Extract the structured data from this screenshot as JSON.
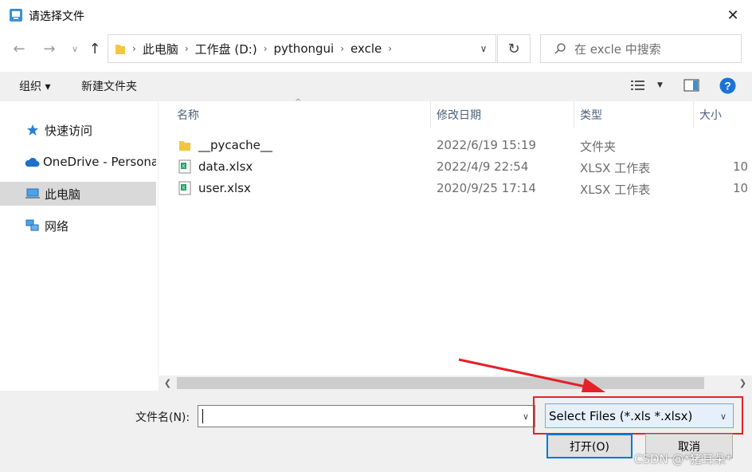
{
  "window": {
    "title": "请选择文件",
    "close_icon": "close-icon"
  },
  "nav": {
    "back_icon": "arrow-left-icon",
    "forward_icon": "arrow-right-icon",
    "recent_icon": "chevron-down-icon",
    "up_icon": "arrow-up-icon"
  },
  "address": {
    "segments": [
      "此电脑",
      "工作盘 (D:)",
      "pythongui",
      "excle"
    ],
    "refresh_icon": "refresh-icon"
  },
  "search": {
    "placeholder": "在 excle 中搜索"
  },
  "toolbar": {
    "organize_label": "组织 ▾",
    "new_folder_label": "新建文件夹",
    "help_icon": "help-icon",
    "view_icon": "view-options-icon",
    "preview_icon": "preview-pane-icon"
  },
  "sidebar": {
    "items": [
      {
        "label": "快速访问",
        "icon": "star-icon"
      },
      {
        "label": "OneDrive - Persona",
        "icon": "cloud-icon"
      },
      {
        "label": "此电脑",
        "icon": "computer-icon",
        "selected": true
      },
      {
        "label": "网络",
        "icon": "network-icon"
      }
    ]
  },
  "columns": {
    "name": "名称",
    "date": "修改日期",
    "type": "类型",
    "size": "大小"
  },
  "files": [
    {
      "name": "__pycache__",
      "date": "2022/6/19 15:19",
      "type": "文件夹",
      "size": "",
      "icon": "folder-icon"
    },
    {
      "name": "data.xlsx",
      "date": "2022/4/9 22:54",
      "type": "XLSX 工作表",
      "size": "10",
      "icon": "excel-file-icon"
    },
    {
      "name": "user.xlsx",
      "date": "2020/9/25 17:14",
      "type": "XLSX 工作表",
      "size": "10",
      "icon": "excel-file-icon"
    }
  ],
  "bottom": {
    "filename_label": "文件名(N):",
    "filename_value": "",
    "filter_value": "Select Files (*.xls *.xlsx)",
    "open_label": "打开(O)",
    "cancel_label": "取消"
  },
  "watermark": "CSDN @*猪耳朵*",
  "colors": {
    "accent": "#0078d7",
    "annotation": "#e5202a",
    "header_text": "#4c607a"
  }
}
